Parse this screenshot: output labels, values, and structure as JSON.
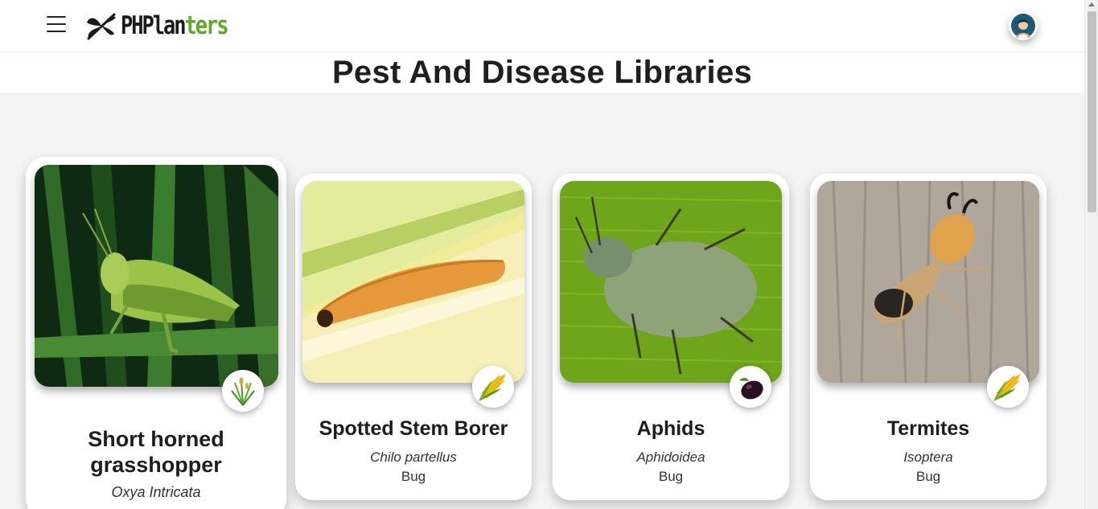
{
  "header": {
    "logo_text_dark": "PHPlan",
    "logo_text_green": "ters"
  },
  "page_title": "Pest And Disease Libraries",
  "pests": [
    {
      "name": "Short horned grasshopper",
      "scientific_name": "Oxya Intricata",
      "type": "",
      "crop_icon": "rice-plant-icon"
    },
    {
      "name": "Spotted Stem Borer",
      "scientific_name": "Chilo partellus",
      "type": "Bug",
      "crop_icon": "corn-icon"
    },
    {
      "name": "Aphids",
      "scientific_name": "Aphidoidea",
      "type": "Bug",
      "crop_icon": "eggplant-icon"
    },
    {
      "name": "Termites",
      "scientific_name": "Isoptera",
      "type": "Bug",
      "crop_icon": "corn-icon"
    }
  ],
  "colors": {
    "brand_green": "#5fa829",
    "text_dark": "#1b1b1b",
    "content_bg": "#f4f4f4"
  }
}
